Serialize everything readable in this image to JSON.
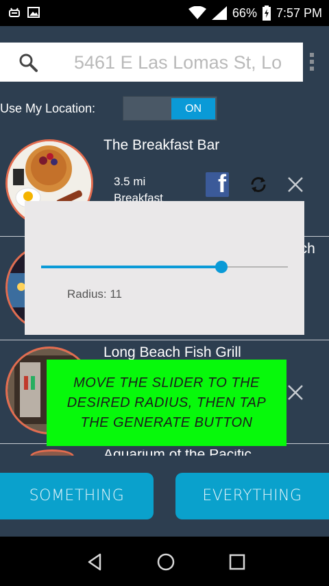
{
  "status_bar": {
    "battery": "66%",
    "time": "7:57 PM",
    "icons": [
      "android-debug-icon",
      "image-icon",
      "wifi-icon",
      "signal-icon",
      "battery-charging-icon"
    ]
  },
  "search": {
    "value": "5461 E Las Lomas St, Lo",
    "icon": "search-icon"
  },
  "location": {
    "label": "Use My Location:",
    "toggle_state": "ON"
  },
  "items": [
    {
      "title": "The Breakfast Bar",
      "distance": "3.5 mi",
      "category": "Breakfast"
    },
    {
      "title": "ach"
    },
    {
      "title": "Long Beach Fish Grill"
    },
    {
      "title": "Aquarium of the Pacific"
    }
  ],
  "dialog": {
    "radius_label": "Radius: 11",
    "slider_value": 0.73
  },
  "hint": {
    "text": "MOVE THE SLIDER TO THE DESIRED RADIUS, THEN TAP THE GENERATE BUTTON"
  },
  "buttons": {
    "something": "SOMETHING",
    "everything": "EVERYTHING"
  },
  "colors": {
    "accent": "#0a9ad7",
    "background": "#2d3e50",
    "hint": "#07f90b",
    "thumb_border": "#e36c4f"
  }
}
